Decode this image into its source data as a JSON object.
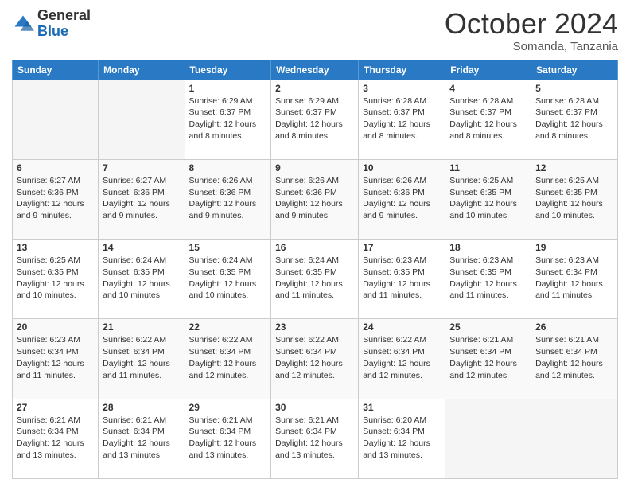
{
  "logo": {
    "general": "General",
    "blue": "Blue"
  },
  "header": {
    "month": "October 2024",
    "location": "Somanda, Tanzania"
  },
  "days_of_week": [
    "Sunday",
    "Monday",
    "Tuesday",
    "Wednesday",
    "Thursday",
    "Friday",
    "Saturday"
  ],
  "weeks": [
    [
      {
        "day": "",
        "info": ""
      },
      {
        "day": "",
        "info": ""
      },
      {
        "day": "1",
        "sunrise": "6:29 AM",
        "sunset": "6:37 PM",
        "daylight": "12 hours and 8 minutes."
      },
      {
        "day": "2",
        "sunrise": "6:29 AM",
        "sunset": "6:37 PM",
        "daylight": "12 hours and 8 minutes."
      },
      {
        "day": "3",
        "sunrise": "6:28 AM",
        "sunset": "6:37 PM",
        "daylight": "12 hours and 8 minutes."
      },
      {
        "day": "4",
        "sunrise": "6:28 AM",
        "sunset": "6:37 PM",
        "daylight": "12 hours and 8 minutes."
      },
      {
        "day": "5",
        "sunrise": "6:28 AM",
        "sunset": "6:37 PM",
        "daylight": "12 hours and 8 minutes."
      }
    ],
    [
      {
        "day": "6",
        "sunrise": "6:27 AM",
        "sunset": "6:36 PM",
        "daylight": "12 hours and 9 minutes."
      },
      {
        "day": "7",
        "sunrise": "6:27 AM",
        "sunset": "6:36 PM",
        "daylight": "12 hours and 9 minutes."
      },
      {
        "day": "8",
        "sunrise": "6:26 AM",
        "sunset": "6:36 PM",
        "daylight": "12 hours and 9 minutes."
      },
      {
        "day": "9",
        "sunrise": "6:26 AM",
        "sunset": "6:36 PM",
        "daylight": "12 hours and 9 minutes."
      },
      {
        "day": "10",
        "sunrise": "6:26 AM",
        "sunset": "6:36 PM",
        "daylight": "12 hours and 9 minutes."
      },
      {
        "day": "11",
        "sunrise": "6:25 AM",
        "sunset": "6:35 PM",
        "daylight": "12 hours and 10 minutes."
      },
      {
        "day": "12",
        "sunrise": "6:25 AM",
        "sunset": "6:35 PM",
        "daylight": "12 hours and 10 minutes."
      }
    ],
    [
      {
        "day": "13",
        "sunrise": "6:25 AM",
        "sunset": "6:35 PM",
        "daylight": "12 hours and 10 minutes."
      },
      {
        "day": "14",
        "sunrise": "6:24 AM",
        "sunset": "6:35 PM",
        "daylight": "12 hours and 10 minutes."
      },
      {
        "day": "15",
        "sunrise": "6:24 AM",
        "sunset": "6:35 PM",
        "daylight": "12 hours and 10 minutes."
      },
      {
        "day": "16",
        "sunrise": "6:24 AM",
        "sunset": "6:35 PM",
        "daylight": "12 hours and 11 minutes."
      },
      {
        "day": "17",
        "sunrise": "6:23 AM",
        "sunset": "6:35 PM",
        "daylight": "12 hours and 11 minutes."
      },
      {
        "day": "18",
        "sunrise": "6:23 AM",
        "sunset": "6:35 PM",
        "daylight": "12 hours and 11 minutes."
      },
      {
        "day": "19",
        "sunrise": "6:23 AM",
        "sunset": "6:34 PM",
        "daylight": "12 hours and 11 minutes."
      }
    ],
    [
      {
        "day": "20",
        "sunrise": "6:23 AM",
        "sunset": "6:34 PM",
        "daylight": "12 hours and 11 minutes."
      },
      {
        "day": "21",
        "sunrise": "6:22 AM",
        "sunset": "6:34 PM",
        "daylight": "12 hours and 11 minutes."
      },
      {
        "day": "22",
        "sunrise": "6:22 AM",
        "sunset": "6:34 PM",
        "daylight": "12 hours and 12 minutes."
      },
      {
        "day": "23",
        "sunrise": "6:22 AM",
        "sunset": "6:34 PM",
        "daylight": "12 hours and 12 minutes."
      },
      {
        "day": "24",
        "sunrise": "6:22 AM",
        "sunset": "6:34 PM",
        "daylight": "12 hours and 12 minutes."
      },
      {
        "day": "25",
        "sunrise": "6:21 AM",
        "sunset": "6:34 PM",
        "daylight": "12 hours and 12 minutes."
      },
      {
        "day": "26",
        "sunrise": "6:21 AM",
        "sunset": "6:34 PM",
        "daylight": "12 hours and 12 minutes."
      }
    ],
    [
      {
        "day": "27",
        "sunrise": "6:21 AM",
        "sunset": "6:34 PM",
        "daylight": "12 hours and 13 minutes."
      },
      {
        "day": "28",
        "sunrise": "6:21 AM",
        "sunset": "6:34 PM",
        "daylight": "12 hours and 13 minutes."
      },
      {
        "day": "29",
        "sunrise": "6:21 AM",
        "sunset": "6:34 PM",
        "daylight": "12 hours and 13 minutes."
      },
      {
        "day": "30",
        "sunrise": "6:21 AM",
        "sunset": "6:34 PM",
        "daylight": "12 hours and 13 minutes."
      },
      {
        "day": "31",
        "sunrise": "6:20 AM",
        "sunset": "6:34 PM",
        "daylight": "12 hours and 13 minutes."
      },
      {
        "day": "",
        "info": ""
      },
      {
        "day": "",
        "info": ""
      }
    ]
  ],
  "labels": {
    "sunrise": "Sunrise:",
    "sunset": "Sunset:",
    "daylight": "Daylight:"
  }
}
